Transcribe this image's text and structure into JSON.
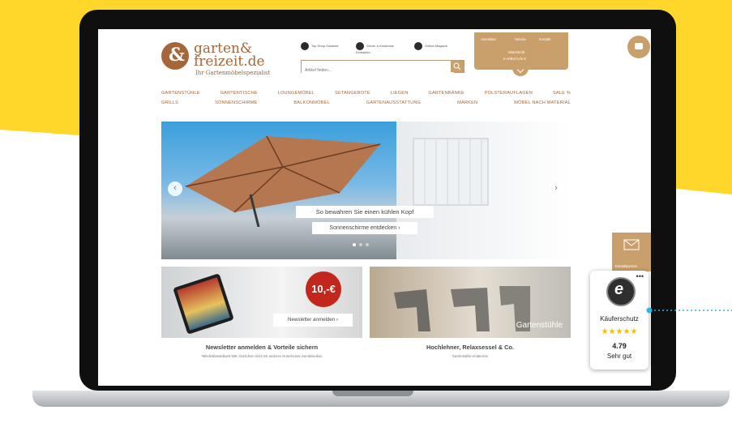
{
  "colors": {
    "background_yellow": "#ffd72a",
    "brand_brown": "#a5673a",
    "brand_gold": "#c9a06b",
    "star_yellow": "#f4c000",
    "connector_cyan": "#29b6e8"
  },
  "logo": {
    "name_line1": "garten&",
    "name_line2": "freizeit.de",
    "tagline": "Ihr Gartenmöbelspezialist"
  },
  "search": {
    "placeholder": "Artikel finden..."
  },
  "header_badges": [
    "Top-Shop Garantie",
    "Sicher & Kostenlos Einkaufen",
    "Online-Magazin"
  ],
  "account": {
    "links": [
      "Anmelden",
      "Service",
      "Kontakt"
    ],
    "cart_label": "Warenkorb",
    "cart_value": "0 Artikel 0,00 €"
  },
  "nav": {
    "row1": [
      "GARTENSTÜHLE",
      "GARTENTISCHE",
      "LOUNGEMÖBEL",
      "SETANGEBOTE",
      "LIEGEN",
      "GARTENBÄNKE",
      "POLSTERAUFLAGEN",
      "SALE %"
    ],
    "row2": [
      "GRILLS",
      "SONNENSCHIRME",
      "BALKONMÖBEL",
      "GARTENAUSSTATTUNG",
      "MARKEN",
      "MÖBEL NACH MATERIAL"
    ]
  },
  "hero": {
    "title": "So bewahren Sie einen kühlen Kopf",
    "cta": "Sonnenschirme entdecken  ›",
    "prev": "‹",
    "next": "›"
  },
  "tiles": [
    {
      "badge": "10,-€",
      "button": "Newsletter anmelden  ›",
      "caption": "Newsletter anmelden & Vorteile sichern",
      "sub": "*Mindestbestellwert 50€. Gutschein nicht mit anderen Gutscheinen kombinierbar."
    },
    {
      "label": "Gartenstühle",
      "caption": "Hochlehner, Relaxsessel & Co.",
      "sub": "Gartenstühle entdecken"
    }
  ],
  "kontakt": {
    "label": "Kontaktperson"
  },
  "trusted_shops": {
    "more": "•••",
    "label": "Käuferschutz",
    "stars": "★★★★★",
    "rating": 4.79,
    "rating_text": "4.79",
    "verdict": "Sehr gut"
  }
}
